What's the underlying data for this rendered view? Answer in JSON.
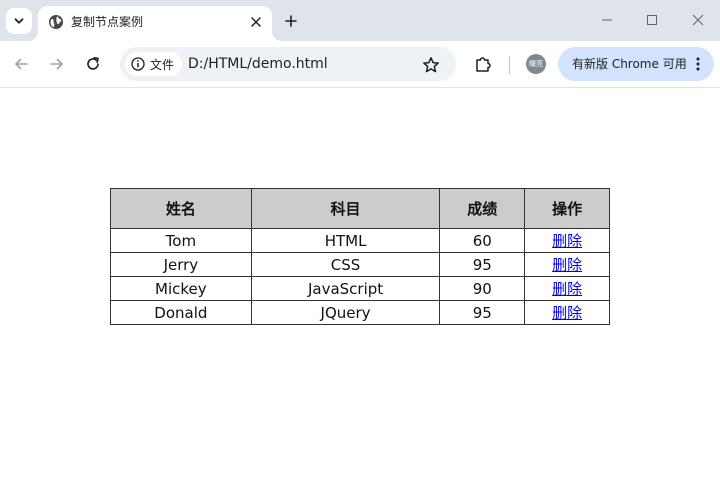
{
  "browser": {
    "tab": {
      "title": "复制节点案例",
      "favicon": "globe-icon"
    },
    "omnibox": {
      "site_label": "文件",
      "url": "D:/HTML/demo.html"
    },
    "profile": {
      "avatar_text": "曙亮"
    },
    "update_chip": {
      "label": "有新版 Chrome 可用"
    }
  },
  "table": {
    "headers": [
      "姓名",
      "科目",
      "成绩",
      "操作"
    ],
    "rows": [
      {
        "name": "Tom",
        "subject": "HTML",
        "score": "60",
        "action": "删除"
      },
      {
        "name": "Jerry",
        "subject": "CSS",
        "score": "95",
        "action": "删除"
      },
      {
        "name": "Mickey",
        "subject": "JavaScript",
        "score": "90",
        "action": "删除"
      },
      {
        "name": "Donald",
        "subject": "JQuery",
        "score": "95",
        "action": "删除"
      }
    ]
  },
  "colors": {
    "header_bg": "#cccccc",
    "link": "#0000ee",
    "tabstrip": "#dfe3eb",
    "update_chip": "#d3e3fd"
  }
}
